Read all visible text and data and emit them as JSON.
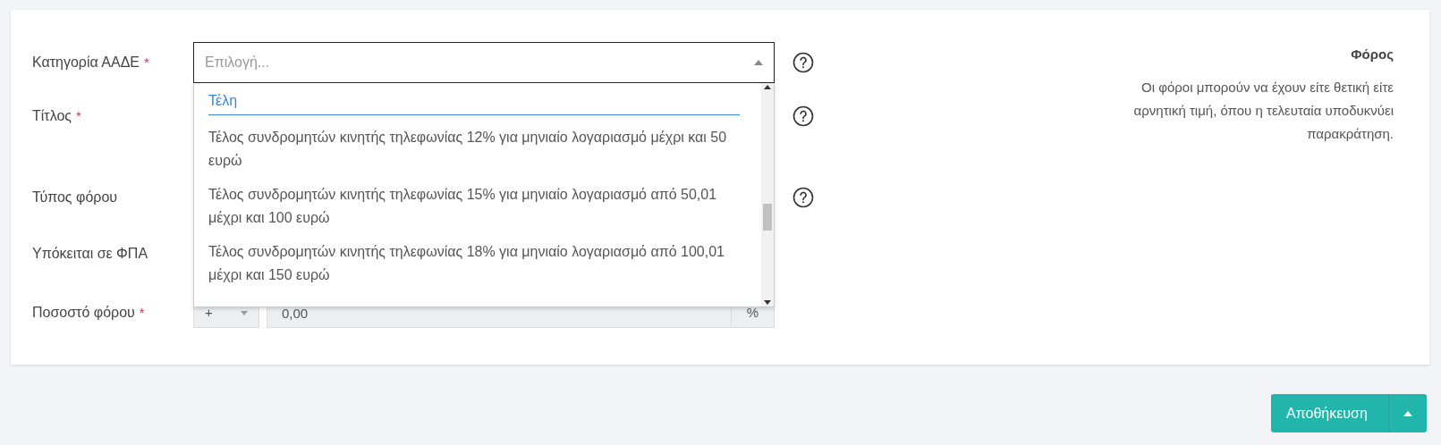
{
  "form": {
    "fields": [
      {
        "label": "Κατηγορία ΑΑΔΕ",
        "required": true,
        "help": true,
        "kind": "select",
        "placeholder": "Επιλογή..."
      },
      {
        "label": "Τίτλος",
        "required": true,
        "help": true,
        "kind": "hidden"
      },
      {
        "label": "Τύπος φόρου",
        "required": false,
        "help": true,
        "kind": "hidden"
      },
      {
        "label": "Υπόκειται σε ΦΠΑ",
        "required": false,
        "help": false,
        "kind": "hidden"
      },
      {
        "label": "Ποσοστό φόρου",
        "required": true,
        "help": false,
        "kind": "rate",
        "sign": "+",
        "value": "0,00",
        "unit": "%"
      }
    ]
  },
  "dropdown": {
    "group": "Τέλη",
    "options": [
      "Τέλος συνδρομητών κινητής τηλεφωνίας 12% για μηνιαίο λογαριασμό μέχρι και 50 ευρώ",
      "Τέλος συνδρομητών κινητής τηλεφωνίας 15% για μηνιαίο λογαριασμό από 50,01 μέχρι και 100 ευρώ",
      "Τέλος συνδρομητών κινητής τηλεφωνίας 18% για μηνιαίο λογαριασμό από 100,01 μέχρι και 150 ευρώ"
    ]
  },
  "required_mark": "*",
  "info": {
    "title": "Φόρος",
    "text": "Οι φόροι μπορούν να έχουν είτε θετική είτε αρνητική τιμή, όπου η τελευταία υποδυκνύει παρακράτηση."
  },
  "save_button": {
    "label": "Αποθήκευση"
  }
}
